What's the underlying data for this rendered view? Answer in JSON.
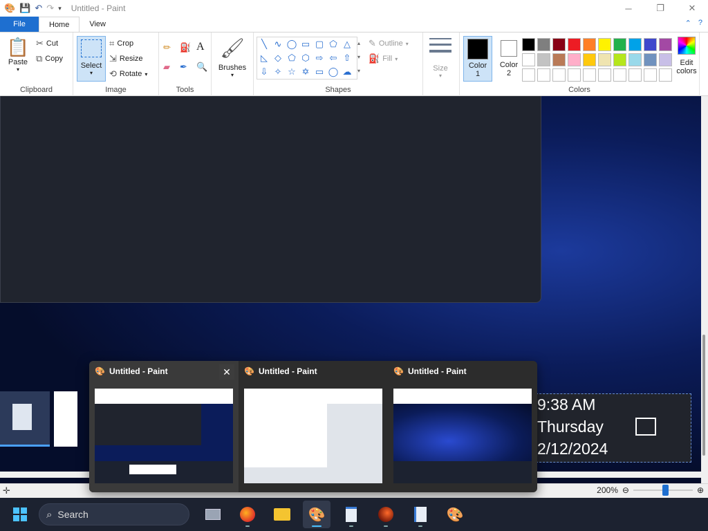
{
  "window": {
    "title": "Untitled - Paint"
  },
  "tabs": {
    "file": "File",
    "home": "Home",
    "view": "View"
  },
  "clipboard": {
    "paste": "Paste",
    "cut": "Cut",
    "copy": "Copy",
    "label": "Clipboard"
  },
  "image": {
    "select": "Select",
    "crop": "Crop",
    "resize": "Resize",
    "rotate": "Rotate",
    "label": "Image"
  },
  "tools": {
    "label": "Tools"
  },
  "brushes": {
    "label": "Brushes"
  },
  "shapes": {
    "outline": "Outline",
    "fill": "Fill",
    "label": "Shapes"
  },
  "size": {
    "label": "Size"
  },
  "colors_group": {
    "color1": "Color",
    "color1_num": "1",
    "color2": "Color",
    "color2_num": "2",
    "edit": "Edit",
    "edit2": "colors",
    "label": "Colors",
    "palette_row1": [
      "#000000",
      "#7f7f7f",
      "#880015",
      "#ed1c24",
      "#ff7f27",
      "#fff200",
      "#22b14c",
      "#00a2e8",
      "#3f48cc",
      "#a349a4"
    ],
    "palette_row2": [
      "#ffffff",
      "#c3c3c3",
      "#b97a57",
      "#ffaec9",
      "#ffc90e",
      "#efe4b0",
      "#b5e61d",
      "#99d9ea",
      "#7092be",
      "#c8bfe7"
    ]
  },
  "canvas_text": {
    "time": "9:38 AM",
    "day": "Thursday",
    "date": "2/12/2024"
  },
  "status": {
    "zoom": "200%"
  },
  "popup": {
    "items": [
      {
        "title": "Untitled - Paint"
      },
      {
        "title": "Untitled - Paint"
      },
      {
        "title": "Untitled - Paint"
      }
    ]
  },
  "taskbar": {
    "search": "Search"
  }
}
